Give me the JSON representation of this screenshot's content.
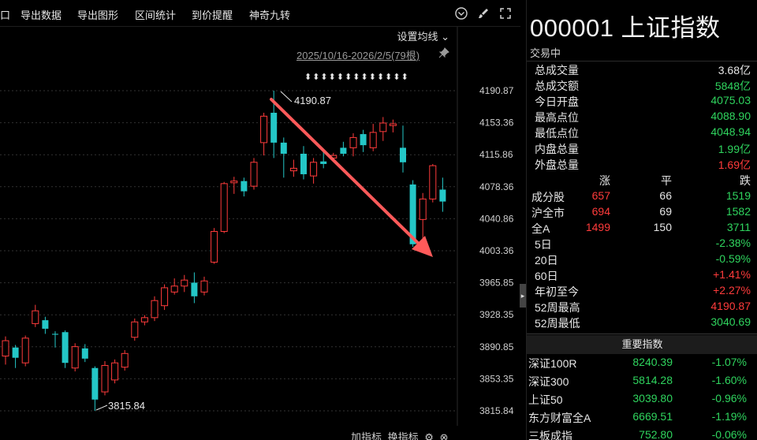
{
  "toolbar": {
    "items": [
      "口",
      "导出数据",
      "导出图形",
      "区间统计",
      "到价提醒",
      "神奇九转"
    ],
    "icons": [
      "chevron-down-circle-icon",
      "brush-icon",
      "expand-icon"
    ]
  },
  "chart": {
    "settings_ma_label": "设置均线",
    "date_range": "2025/10/16-2026/2/5(79根)",
    "high_annotation": "4190.87",
    "low_annotation": "3815.84",
    "arrow_row": "⬍⬍⬍⬍⬍⬍⬍⬍⬍⬍⬍⬍⬍",
    "colors": {
      "up": "#ff3b3b",
      "down": "#24c7c7",
      "grid": "#333333",
      "arrow": "#ff5a5a"
    }
  },
  "chart_data": {
    "type": "candlestick",
    "y_ticks": [
      "4190.87",
      "4153.36",
      "4115.86",
      "4078.36",
      "4040.86",
      "4003.36",
      "3965.85",
      "3928.35",
      "3890.85",
      "3853.35",
      "3815.84"
    ],
    "ylim": [
      3815.84,
      4190.87
    ],
    "candles": [
      {
        "o": 3880,
        "c": 3898,
        "h": 3903,
        "l": 3870
      },
      {
        "o": 3890,
        "c": 3878,
        "h": 3893,
        "l": 3866
      },
      {
        "o": 3872,
        "c": 3901,
        "h": 3904,
        "l": 3868
      },
      {
        "o": 3918,
        "c": 3933,
        "h": 3940,
        "l": 3914
      },
      {
        "o": 3922,
        "c": 3912,
        "h": 3926,
        "l": 3906
      },
      {
        "o": 3906,
        "c": 3905,
        "h": 3909,
        "l": 3890
      },
      {
        "o": 3908,
        "c": 3872,
        "h": 3910,
        "l": 3866
      },
      {
        "o": 3866,
        "c": 3891,
        "h": 3895,
        "l": 3862
      },
      {
        "o": 3889,
        "c": 3877,
        "h": 3894,
        "l": 3873
      },
      {
        "o": 3866,
        "c": 3829,
        "h": 3868,
        "l": 3815.84
      },
      {
        "o": 3838,
        "c": 3869,
        "h": 3874,
        "l": 3834
      },
      {
        "o": 3852,
        "c": 3872,
        "h": 3876,
        "l": 3848
      },
      {
        "o": 3867,
        "c": 3883,
        "h": 3887,
        "l": 3863
      },
      {
        "o": 3902,
        "c": 3920,
        "h": 3924,
        "l": 3898
      },
      {
        "o": 3920,
        "c": 3925,
        "h": 3928,
        "l": 3916
      },
      {
        "o": 3925,
        "c": 3945,
        "h": 3950,
        "l": 3921
      },
      {
        "o": 3939,
        "c": 3960,
        "h": 3964,
        "l": 3934
      },
      {
        "o": 3955,
        "c": 3962,
        "h": 3971,
        "l": 3952
      },
      {
        "o": 3962,
        "c": 3969,
        "h": 3975,
        "l": 3955
      },
      {
        "o": 3966,
        "c": 3950,
        "h": 3978,
        "l": 3942
      },
      {
        "o": 3955,
        "c": 3968,
        "h": 3973,
        "l": 3951
      },
      {
        "o": 3990,
        "c": 4026,
        "h": 4030,
        "l": 3988
      },
      {
        "o": 4026,
        "c": 4082,
        "h": 4084,
        "l": 4024
      },
      {
        "o": 4083,
        "c": 4085,
        "h": 4090,
        "l": 4070
      },
      {
        "o": 4085,
        "c": 4073,
        "h": 4089,
        "l": 4067
      },
      {
        "o": 4079,
        "c": 4107,
        "h": 4112,
        "l": 4075
      },
      {
        "o": 4130,
        "c": 4161,
        "h": 4165,
        "l": 4115
      },
      {
        "o": 4165,
        "c": 4130,
        "h": 4190.87,
        "l": 4112
      },
      {
        "o": 4130,
        "c": 4117,
        "h": 4136,
        "l": 4089
      },
      {
        "o": 4097,
        "c": 4100,
        "h": 4110,
        "l": 4090
      },
      {
        "o": 4117,
        "c": 4093,
        "h": 4126,
        "l": 4087
      },
      {
        "o": 4091,
        "c": 4107,
        "h": 4112,
        "l": 4082
      },
      {
        "o": 4108,
        "c": 4105,
        "h": 4120,
        "l": 4100
      },
      {
        "o": 4112,
        "c": 4115,
        "h": 4118,
        "l": 4108
      },
      {
        "o": 4124,
        "c": 4117,
        "h": 4131,
        "l": 4114
      },
      {
        "o": 4124,
        "c": 4136,
        "h": 4141,
        "l": 4114
      },
      {
        "o": 4140,
        "c": 4127,
        "h": 4145,
        "l": 4119
      },
      {
        "o": 4124,
        "c": 4142,
        "h": 4152,
        "l": 4120
      },
      {
        "o": 4143,
        "c": 4153,
        "h": 4160,
        "l": 4132
      },
      {
        "o": 4150,
        "c": 4152,
        "h": 4157,
        "l": 4142
      },
      {
        "o": 4124,
        "c": 4107,
        "h": 4150,
        "l": 4095
      },
      {
        "o": 4081,
        "c": 4011,
        "h": 4086,
        "l": 4008
      },
      {
        "o": 4040,
        "c": 4064,
        "h": 4071,
        "l": 4005
      },
      {
        "o": 4064,
        "c": 4103,
        "h": 4105,
        "l": 4060
      },
      {
        "o": 4075,
        "c": 4061,
        "h": 4089,
        "l": 4049
      }
    ]
  },
  "bottom_bar": {
    "add_indicator": "加指标",
    "switch_indicator": "换指标"
  },
  "info": {
    "title": "000001 上证指数",
    "status": "交易中",
    "stats": [
      {
        "label": "总成交量",
        "value": "3.68亿",
        "color": "white"
      },
      {
        "label": "总成交额",
        "value": "5848亿",
        "color": "green"
      },
      {
        "label": "今日开盘",
        "value": "4075.03",
        "color": "green"
      },
      {
        "label": "最高点位",
        "value": "4088.90",
        "color": "green"
      },
      {
        "label": "最低点位",
        "value": "4048.94",
        "color": "green"
      },
      {
        "label": "内盘总量",
        "value": "1.99亿",
        "color": "green"
      },
      {
        "label": "外盘总量",
        "value": "1.69亿",
        "color": "red"
      }
    ],
    "breadth_header": [
      "",
      "涨",
      "平",
      "跌"
    ],
    "breadth": [
      {
        "label": "成分股",
        "up": "657",
        "flat": "66",
        "down": "1519"
      },
      {
        "label": "沪全市",
        "up": "694",
        "flat": "69",
        "down": "1582"
      },
      {
        "label": "全A",
        "up": "1499",
        "flat": "150",
        "down": "3711"
      }
    ],
    "perf": [
      {
        "label": "5日",
        "value": "-2.38%",
        "color": "green"
      },
      {
        "label": "20日",
        "value": "-0.59%",
        "color": "green"
      },
      {
        "label": "60日",
        "value": "+1.41%",
        "color": "red"
      },
      {
        "label": "年初至今",
        "value": "+2.27%",
        "color": "red"
      },
      {
        "label": "52周最高",
        "value": "4190.87",
        "color": "red"
      },
      {
        "label": "52周最低",
        "value": "3040.69",
        "color": "green"
      }
    ],
    "key_index_title": "重要指数",
    "indices": [
      {
        "name": "深证100R",
        "price": "8240.39",
        "pct": "-1.07%",
        "color": "green"
      },
      {
        "name": "深证300",
        "price": "5814.28",
        "pct": "-1.60%",
        "color": "green"
      },
      {
        "name": "上证50",
        "price": "3039.80",
        "pct": "-0.96%",
        "color": "green"
      },
      {
        "name": "东方财富全A",
        "price": "6669.51",
        "pct": "-1.19%",
        "color": "green"
      },
      {
        "name": "三板成指",
        "price": "752.80",
        "pct": "-0.06%",
        "color": "green"
      }
    ]
  }
}
